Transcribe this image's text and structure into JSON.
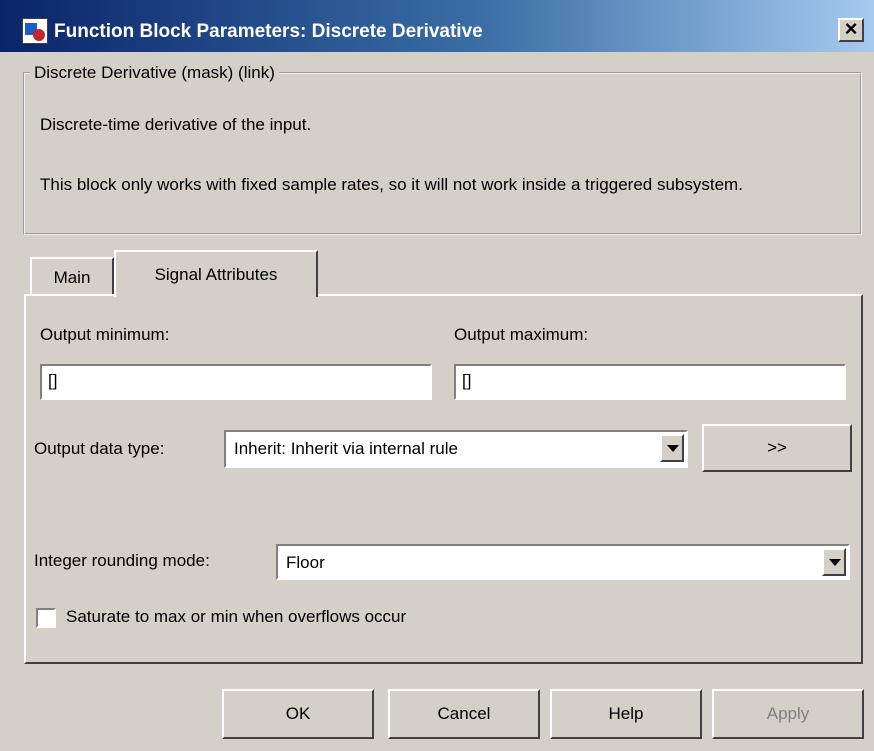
{
  "window": {
    "title": "Function Block Parameters: Discrete Derivative",
    "close_glyph": "×"
  },
  "description": {
    "group_label": "Discrete Derivative (mask) (link)",
    "line1": "Discrete-time derivative of the input.",
    "line2": "This block only works with fixed sample rates, so it will not work inside a triggered subsystem."
  },
  "tabs": [
    {
      "label": "Main",
      "active": false
    },
    {
      "label": "Signal Attributes",
      "active": true
    }
  ],
  "signal_attributes": {
    "output_min_label": "Output minimum:",
    "output_min_value": "[]",
    "output_max_label": "Output maximum:",
    "output_max_value": "[]",
    "data_type_label": "Output data type:",
    "data_type_value": "Inherit: Inherit via internal rule",
    "assistant_button_label": ">>",
    "rounding_label": "Integer rounding mode:",
    "rounding_value": "Floor",
    "saturate_label": "Saturate to max or min when overflows occur",
    "saturate_checked": false
  },
  "buttons": {
    "ok": "OK",
    "cancel": "Cancel",
    "help": "Help",
    "apply": "Apply"
  },
  "colors": {
    "window_bg": "#d4d0c8",
    "title_start": "#0a246a",
    "title_end": "#a6caf0",
    "disabled_text": "#808080"
  }
}
